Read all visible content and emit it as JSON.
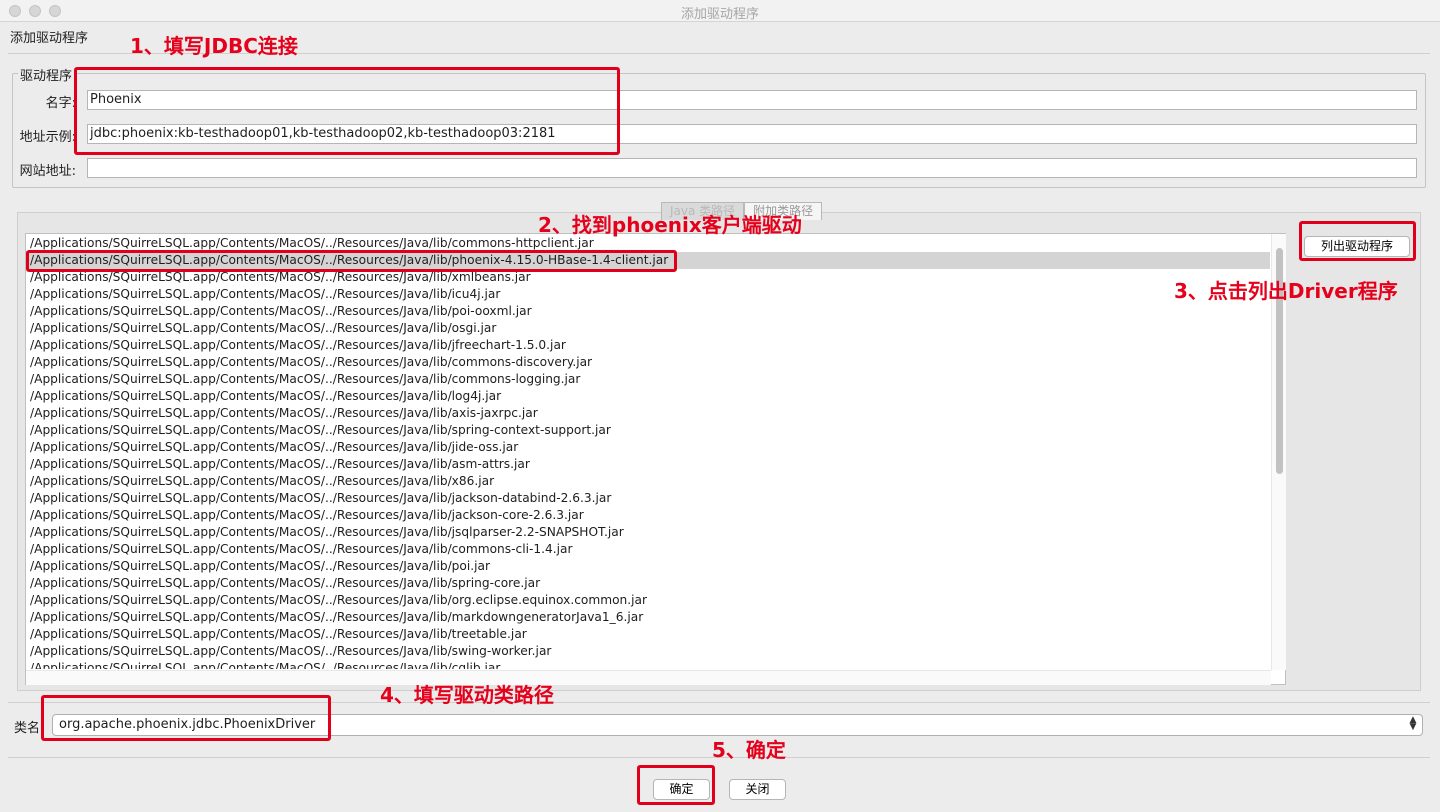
{
  "window": {
    "title": "添加驱动程序"
  },
  "dialog": {
    "header": "添加驱动程序"
  },
  "driver_group": {
    "title": "驱动程序",
    "name_label": "名字:",
    "name_value": "Phoenix",
    "url_label": "地址示例:",
    "url_value": "jdbc:phoenix:kb-testhadoop01,kb-testhadoop02,kb-testhadoop03:2181",
    "website_label": "网站地址:",
    "website_value": ""
  },
  "tabs": [
    {
      "label": "Java 类路径",
      "selected": true
    },
    {
      "label": "附加类路径",
      "selected": false
    }
  ],
  "classpath": {
    "selected_index": 1,
    "items": [
      "/Applications/SQuirreLSQL.app/Contents/MacOS/../Resources/Java/lib/commons-httpclient.jar",
      "/Applications/SQuirreLSQL.app/Contents/MacOS/../Resources/Java/lib/phoenix-4.15.0-HBase-1.4-client.jar",
      "/Applications/SQuirreLSQL.app/Contents/MacOS/../Resources/Java/lib/xmlbeans.jar",
      "/Applications/SQuirreLSQL.app/Contents/MacOS/../Resources/Java/lib/icu4j.jar",
      "/Applications/SQuirreLSQL.app/Contents/MacOS/../Resources/Java/lib/poi-ooxml.jar",
      "/Applications/SQuirreLSQL.app/Contents/MacOS/../Resources/Java/lib/osgi.jar",
      "/Applications/SQuirreLSQL.app/Contents/MacOS/../Resources/Java/lib/jfreechart-1.5.0.jar",
      "/Applications/SQuirreLSQL.app/Contents/MacOS/../Resources/Java/lib/commons-discovery.jar",
      "/Applications/SQuirreLSQL.app/Contents/MacOS/../Resources/Java/lib/commons-logging.jar",
      "/Applications/SQuirreLSQL.app/Contents/MacOS/../Resources/Java/lib/log4j.jar",
      "/Applications/SQuirreLSQL.app/Contents/MacOS/../Resources/Java/lib/axis-jaxrpc.jar",
      "/Applications/SQuirreLSQL.app/Contents/MacOS/../Resources/Java/lib/spring-context-support.jar",
      "/Applications/SQuirreLSQL.app/Contents/MacOS/../Resources/Java/lib/jide-oss.jar",
      "/Applications/SQuirreLSQL.app/Contents/MacOS/../Resources/Java/lib/asm-attrs.jar",
      "/Applications/SQuirreLSQL.app/Contents/MacOS/../Resources/Java/lib/x86.jar",
      "/Applications/SQuirreLSQL.app/Contents/MacOS/../Resources/Java/lib/jackson-databind-2.6.3.jar",
      "/Applications/SQuirreLSQL.app/Contents/MacOS/../Resources/Java/lib/jackson-core-2.6.3.jar",
      "/Applications/SQuirreLSQL.app/Contents/MacOS/../Resources/Java/lib/jsqlparser-2.2-SNAPSHOT.jar",
      "/Applications/SQuirreLSQL.app/Contents/MacOS/../Resources/Java/lib/commons-cli-1.4.jar",
      "/Applications/SQuirreLSQL.app/Contents/MacOS/../Resources/Java/lib/poi.jar",
      "/Applications/SQuirreLSQL.app/Contents/MacOS/../Resources/Java/lib/spring-core.jar",
      "/Applications/SQuirreLSQL.app/Contents/MacOS/../Resources/Java/lib/org.eclipse.equinox.common.jar",
      "/Applications/SQuirreLSQL.app/Contents/MacOS/../Resources/Java/lib/markdowngeneratorJava1_6.jar",
      "/Applications/SQuirreLSQL.app/Contents/MacOS/../Resources/Java/lib/treetable.jar",
      "/Applications/SQuirreLSQL.app/Contents/MacOS/../Resources/Java/lib/swing-worker.jar",
      "/Applications/SQuirreLSQL.app/Contents/MacOS/../Resources/Java/lib/cglib.jar"
    ]
  },
  "buttons": {
    "list_drivers": "列出驱动程序",
    "ok": "确定",
    "close": "关闭"
  },
  "class_name": {
    "label": "类名",
    "value": "org.apache.phoenix.jdbc.PhoenixDriver"
  },
  "annotations": {
    "step1": "1、填写JDBC连接",
    "step2": "2、找到phoenix客户端驱动",
    "step3": "3、点击列出Driver程序",
    "step4": "4、填写驱动类路径",
    "step5": "5、确定"
  },
  "colors": {
    "annotation_red": "#e0001b",
    "selected_row": "#d4d4d4"
  }
}
